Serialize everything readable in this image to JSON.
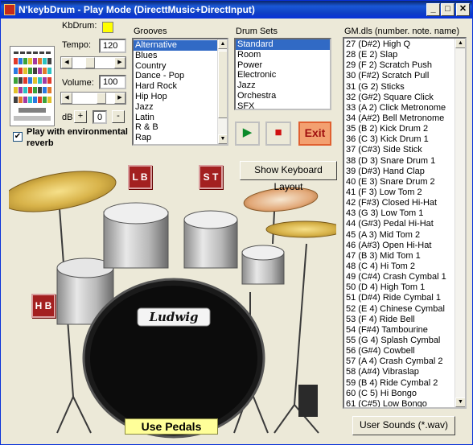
{
  "window": {
    "title": "N'keybDrum - Play Mode  (DirecttMusic+DirectInput)",
    "minimize": "_",
    "maximize": "□",
    "close": "✕"
  },
  "controls": {
    "kbdrum_label": "KbDrum:",
    "kbdrum_color": "#ffff00",
    "tempo_label": "Tempo:",
    "tempo_value": "120",
    "volume_label": "Volume:",
    "volume_value": "100",
    "db_label": "dB",
    "db_plus": "+",
    "db_value": "0",
    "db_minus": "-",
    "reverb_label": "Play with environmental reverb"
  },
  "grooves": {
    "label": "Grooves",
    "items": [
      "Alternative",
      "Blues",
      "Country",
      "Dance - Pop",
      "Hard Rock",
      "Hip Hop",
      "Jazz",
      "Latin",
      "R & B",
      "Rap"
    ],
    "selected_index": 0
  },
  "drum_sets": {
    "label": "Drum Sets",
    "items": [
      "Standard",
      "Room",
      "Power",
      "Electronic",
      "Jazz",
      "Orchestra",
      "SFX"
    ],
    "selected_index": 0
  },
  "transport": {
    "play_icon": "▶",
    "stop_icon": "■",
    "exit_label": "Exit"
  },
  "buttons": {
    "show_keyboard": "Show Keyboard Layout",
    "use_pedals": "Use Pedals",
    "user_sounds": "User Sounds (*.wav)"
  },
  "pads": {
    "lb": "L B",
    "st": "S T",
    "hb": "H B"
  },
  "kit": {
    "bass_drum_logo": "Ludwig"
  },
  "gm": {
    "label": "GM.dls (number. note. name)",
    "items": [
      "27 (D#2)  High Q",
      "28 (E 2)  Slap",
      "29 (F 2)  Scratch Push",
      "30 (F#2)  Scratch Pull",
      "31 (G 2)  Sticks",
      "32 (G#2)  Square Click",
      "33 (A 2)  Click Metronome",
      "34 (A#2)  Bell Metronome",
      "35 (B 2)  Kick Drum 2",
      "36 (C 3)  Kick Drum 1",
      "37 (C#3)  Side Stick",
      "38 (D 3)  Snare Drum 1",
      "39 (D#3)  Hand Clap",
      "40 (E 3)  Snare Drum 2",
      "41 (F 3)  Low Tom 2",
      "42 (F#3)  Closed Hi-Hat",
      "43 (G 3)  Low Tom 1",
      "44 (G#3)  Pedal Hi-Hat",
      "45 (A 3)  Mid Tom 2",
      "46 (A#3)  Open Hi-Hat",
      "47 (B 3)  Mid Tom 1",
      "48 (C 4)  Hi Tom 2",
      "49 (C#4)  Crash Cymbal 1",
      "50 (D 4)  High Tom 1",
      "51 (D#4)  Ride Cymbal 1",
      "52 (E 4)  Chinese Cymbal",
      "53 (F 4)  Ride Bell",
      "54 (F#4)  Tambourine",
      "55 (G 4)  Splash Cymbal",
      "56 (G#4)  Cowbell",
      "57 (A 4)  Crash Cymbal 2",
      "58 (A#4)  Vibraslap",
      "59 (B 4)  Ride Cymbal 2",
      "60 (C 5)  Hi Bongo",
      "61 (C#5)  Low Bongo"
    ]
  }
}
